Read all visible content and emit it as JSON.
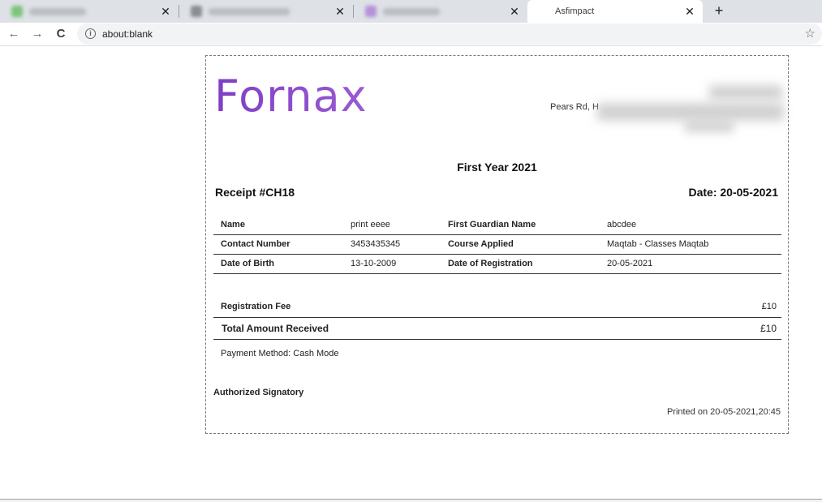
{
  "browser": {
    "tabs": [
      {
        "title": "",
        "close": "✕"
      },
      {
        "title": "",
        "close": "✕"
      },
      {
        "title": "",
        "close": "✕"
      },
      {
        "title": "Asfimpact",
        "close": "✕"
      }
    ],
    "new_tab": "+",
    "back": "←",
    "forward": "→",
    "reload": "C",
    "url": "about:blank",
    "info_icon": "i",
    "bookmark_icon": "☆"
  },
  "receipt": {
    "logo": "Fornax",
    "address_visible": "Pears Rd, H",
    "heading": "First Year 2021",
    "receipt_no": "Receipt #CH18",
    "date": "Date: 20-05-2021",
    "info_rows": [
      {
        "label1": "Name",
        "value1": "print eeee",
        "label2": "First Guardian Name",
        "value2": "abcdee"
      },
      {
        "label1": "Contact Number",
        "value1": "3453435345",
        "label2": "Course Applied",
        "value2": "Maqtab - Classes Maqtab"
      },
      {
        "label1": "Date of Birth",
        "value1": "13-10-2009",
        "label2": "Date of Registration",
        "value2": "20-05-2021"
      }
    ],
    "registration_fee_label": "Registration Fee",
    "registration_fee_amount": "£10",
    "total_label": "Total Amount Received",
    "total_amount": "£10",
    "payment_method": "Payment Method: Cash Mode",
    "signatory": "Authorized Signatory",
    "printed_on": "Printed on 20-05-2021,20:45"
  }
}
